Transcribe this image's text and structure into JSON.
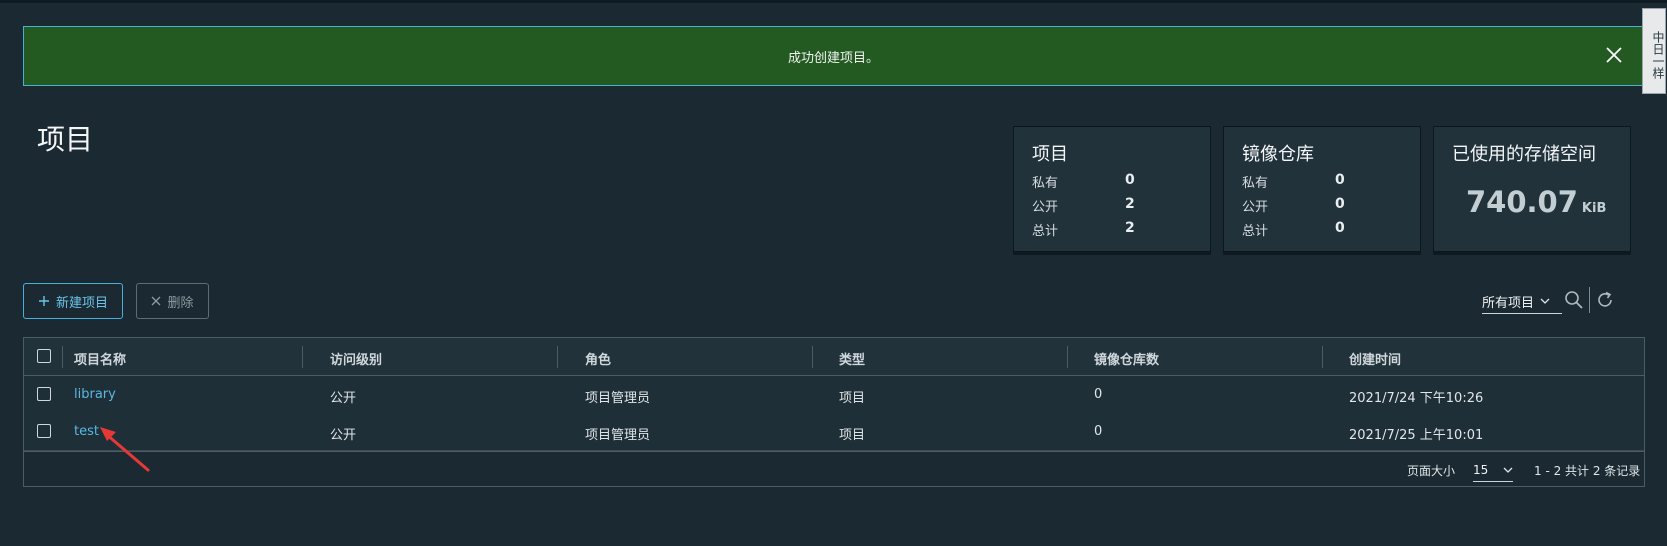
{
  "banner": {
    "message": "成功创建项目。",
    "close_icon": "close-icon"
  },
  "side_tab": {
    "label": "中日一样"
  },
  "page": {
    "title": "项目"
  },
  "cards": {
    "projects": {
      "title": "项目",
      "rows": [
        {
          "label": "私有",
          "value": "0"
        },
        {
          "label": "公开",
          "value": "2"
        },
        {
          "label": "总计",
          "value": "2"
        }
      ]
    },
    "repositories": {
      "title": "镜像仓库",
      "rows": [
        {
          "label": "私有",
          "value": "0"
        },
        {
          "label": "公开",
          "value": "0"
        },
        {
          "label": "总计",
          "value": "0"
        }
      ]
    },
    "storage": {
      "title": "已使用的存储空间",
      "value": "740.07",
      "unit": "KiB"
    }
  },
  "toolbar": {
    "new_label": "新建项目",
    "delete_label": "删除",
    "filter_label": "所有项目",
    "search_icon": "search-icon",
    "refresh_icon": "refresh-icon"
  },
  "table": {
    "columns": [
      "项目名称",
      "访问级别",
      "角色",
      "类型",
      "镜像仓库数",
      "创建时间"
    ],
    "rows": [
      {
        "name": "library",
        "access": "公开",
        "role": "项目管理员",
        "type": "项目",
        "repo_count": "0",
        "created": "2021/7/24 下午10:26"
      },
      {
        "name": "test",
        "access": "公开",
        "role": "项目管理员",
        "type": "项目",
        "repo_count": "0",
        "created": "2021/7/25 上午10:01"
      }
    ]
  },
  "pagination": {
    "page_size_label": "页面大小",
    "page_size": "15",
    "summary": "1 - 2 共计 2 条记录"
  },
  "colors": {
    "background": "#1b2a32",
    "banner": "#235a22",
    "accent": "#4aaed9",
    "link": "#59b7e2",
    "annotation_arrow": "#e53935"
  }
}
